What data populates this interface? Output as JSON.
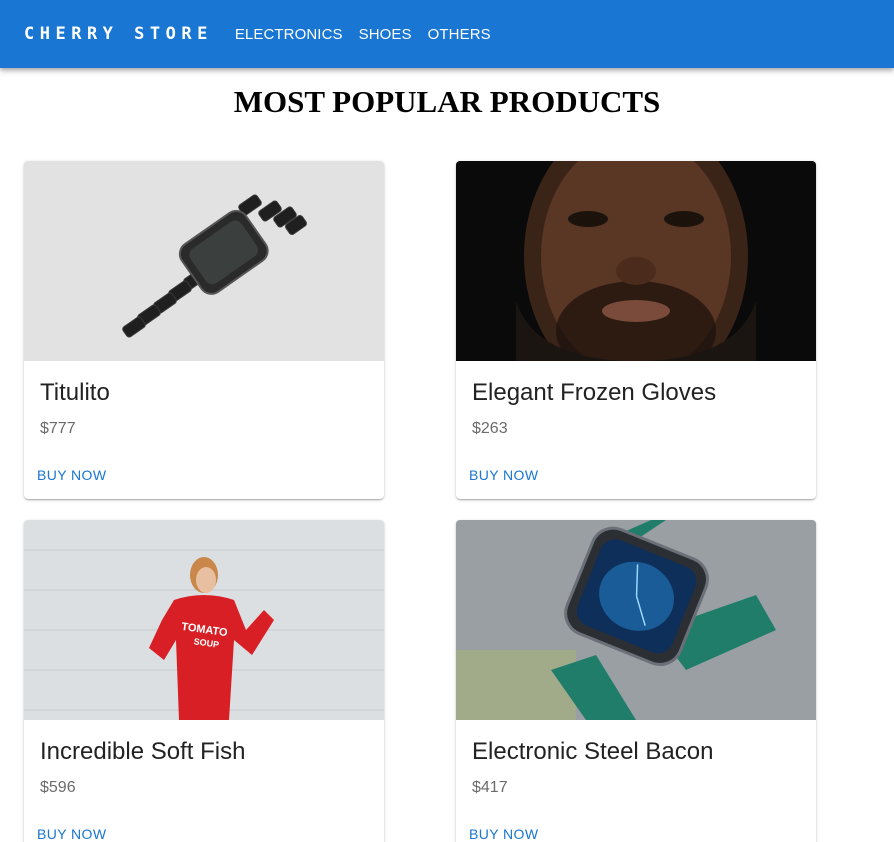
{
  "appbar": {
    "brand": "CHERRY STORE",
    "nav": [
      "ELECTRONICS",
      "SHOES",
      "OTHERS"
    ],
    "color": "#1976d2"
  },
  "page": {
    "title": "MOST POPULAR PRODUCTS"
  },
  "products": [
    {
      "name": "Titulito",
      "price": "$777",
      "action": "BUY NOW",
      "image": "black-smartwatch-photo"
    },
    {
      "name": "Elegant Frozen Gloves",
      "price": "$263",
      "action": "BUY NOW",
      "image": "man-portrait-photo"
    },
    {
      "name": "Incredible Soft Fish",
      "price": "$596",
      "action": "BUY NOW",
      "image": "woman-red-sweater-photo"
    },
    {
      "name": "Electronic Steel Bacon",
      "price": "$417",
      "action": "BUY NOW",
      "image": "green-band-smartwatch-photo"
    }
  ]
}
